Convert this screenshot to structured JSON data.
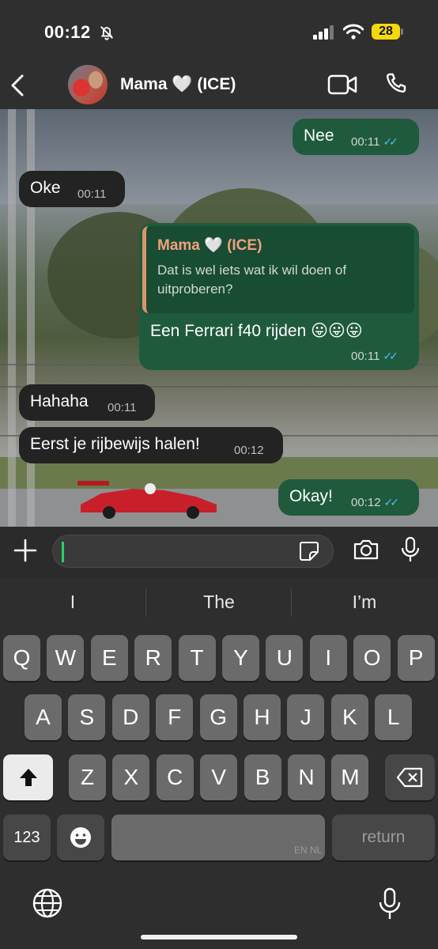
{
  "status": {
    "time": "00:12",
    "battery": "28"
  },
  "header": {
    "contact_name": "Mama 🤍 (ICE)"
  },
  "messages": [
    {
      "dir": "out",
      "text": "Nee",
      "time": "00:11"
    },
    {
      "dir": "in",
      "text": "Oke",
      "time": "00:11"
    },
    {
      "dir": "out",
      "quote_name": "Mama 🤍 (ICE)",
      "quote_text": "Dat is wel iets wat ik wil doen of uitproberen?",
      "text": "Een Ferrari f40 rijden 😛😛😛",
      "time": "00:11"
    },
    {
      "dir": "in",
      "text": "Hahaha",
      "time": "00:11"
    },
    {
      "dir": "in",
      "text": "Eerst je rijbewijs halen!",
      "time": "00:12"
    },
    {
      "dir": "out",
      "text": "Okay!",
      "time": "00:12"
    }
  ],
  "input": {
    "value": ""
  },
  "keyboard": {
    "suggestions": [
      "I",
      "The",
      "I’m"
    ],
    "row1": [
      "Q",
      "W",
      "E",
      "R",
      "T",
      "Y",
      "U",
      "I",
      "O",
      "P"
    ],
    "row2": [
      "A",
      "S",
      "D",
      "F",
      "G",
      "H",
      "J",
      "K",
      "L"
    ],
    "row3": [
      "Z",
      "X",
      "C",
      "V",
      "B",
      "N",
      "M"
    ],
    "numbers_label": "123",
    "return_label": "return",
    "language_label": "EN NL"
  },
  "colors": {
    "outgoing_bubble": "#1f5a3d",
    "incoming_bubble": "#222322",
    "read_ticks": "#53bdeb",
    "quote_accent": "#e0926d",
    "battery": "#f5d90a"
  },
  "icons": [
    "bell-slash-icon",
    "signal-icon",
    "wifi-icon",
    "back-icon",
    "video-call-icon",
    "phone-icon",
    "plus-icon",
    "sticker-icon",
    "camera-icon",
    "mic-icon",
    "shift-icon",
    "backspace-icon",
    "emoji-icon",
    "globe-icon",
    "dictation-icon"
  ]
}
